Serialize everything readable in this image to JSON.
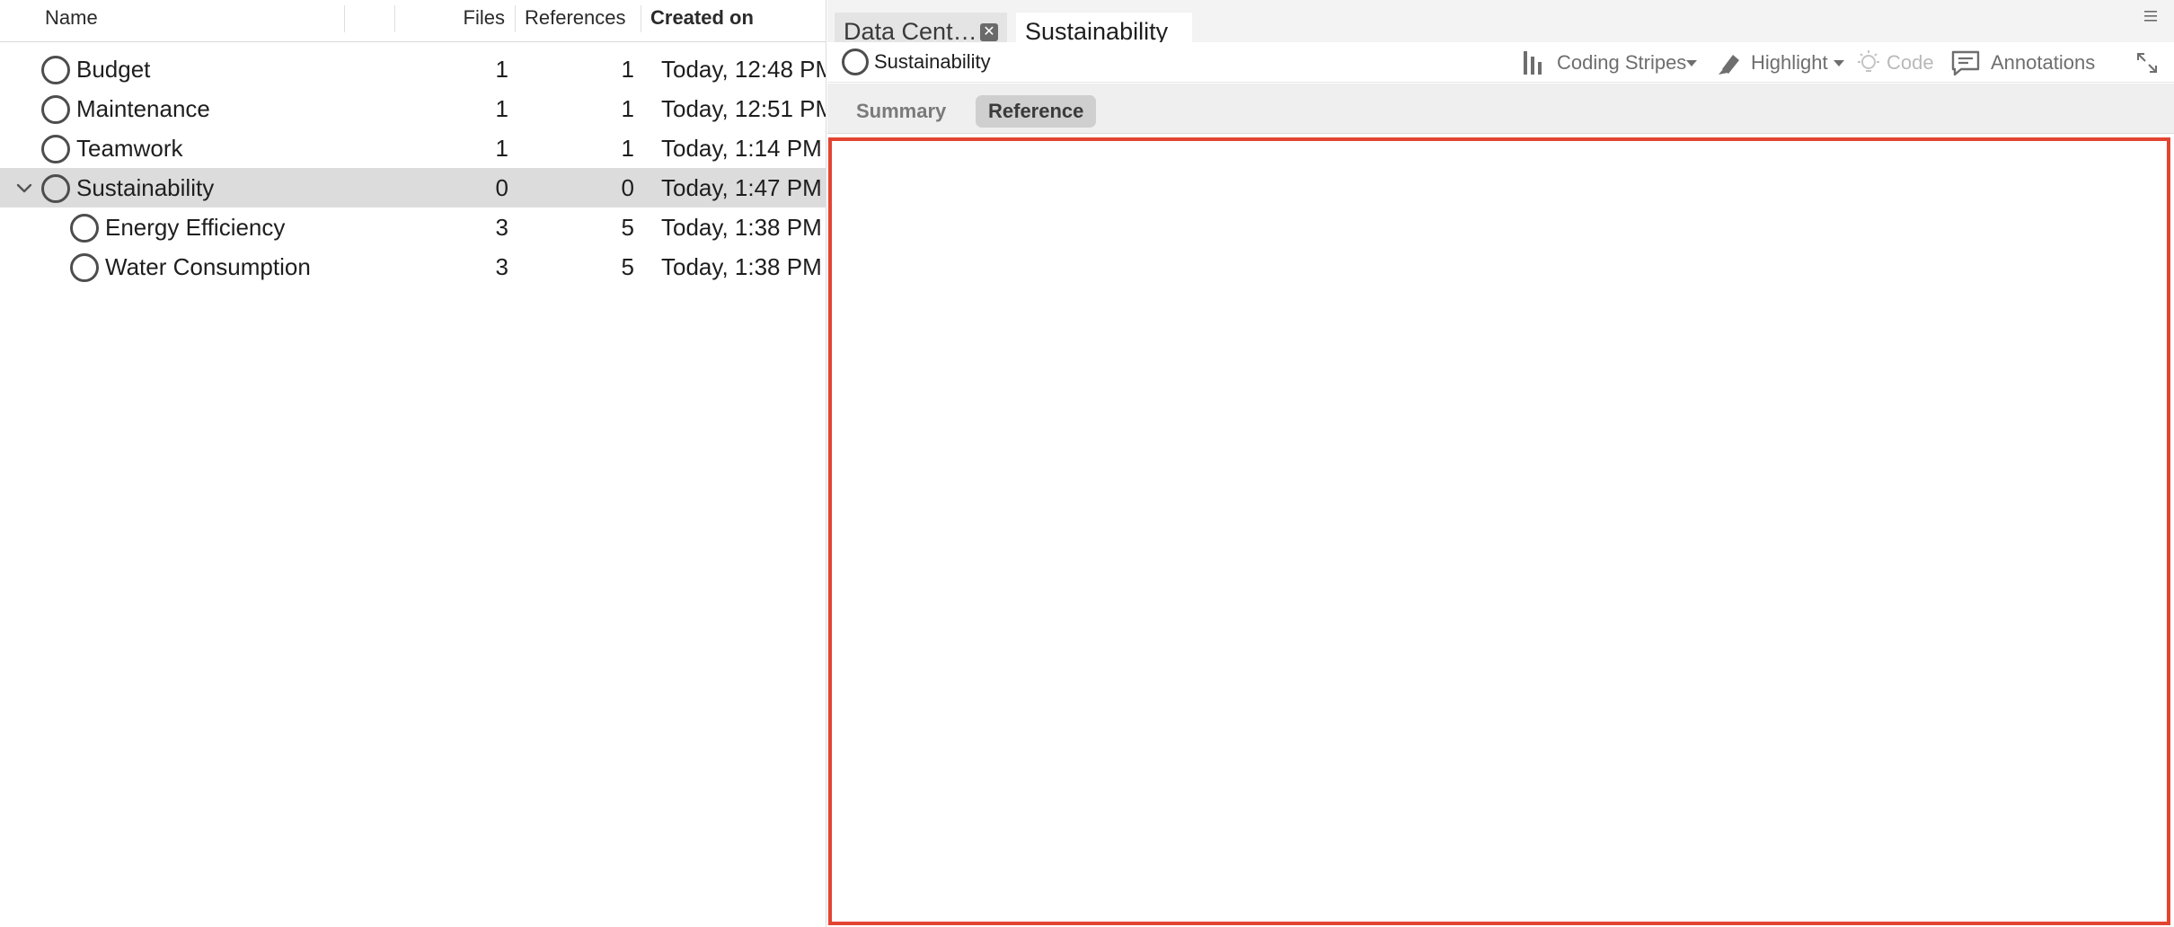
{
  "columns": {
    "name": "Name",
    "files": "Files",
    "references": "References",
    "created_on": "Created on"
  },
  "rows": [
    {
      "name": "Budget",
      "files": "1",
      "references": "1",
      "created": "Today, 12:48 PM",
      "level": 0,
      "expanded": false,
      "selected": false
    },
    {
      "name": "Maintenance",
      "files": "1",
      "references": "1",
      "created": "Today, 12:51 PM",
      "level": 0,
      "expanded": false,
      "selected": false
    },
    {
      "name": "Teamwork",
      "files": "1",
      "references": "1",
      "created": "Today, 1:14 PM",
      "level": 0,
      "expanded": false,
      "selected": false
    },
    {
      "name": "Sustainability",
      "files": "0",
      "references": "0",
      "created": "Today, 1:47 PM",
      "level": 0,
      "expanded": true,
      "selected": true
    },
    {
      "name": "Energy Efficiency",
      "files": "3",
      "references": "5",
      "created": "Today, 1:38 PM",
      "level": 1,
      "expanded": false,
      "selected": false
    },
    {
      "name": "Water Consumption",
      "files": "3",
      "references": "5",
      "created": "Today, 1:38 PM",
      "level": 1,
      "expanded": false,
      "selected": false
    }
  ],
  "tabs": [
    {
      "label": "Data Cent…",
      "closable": true,
      "active": false
    },
    {
      "label": "Sustainability",
      "closable": false,
      "active": true
    }
  ],
  "toolbar": {
    "title": "Sustainability",
    "coding_stripes": "Coding Stripes",
    "highlight": "Highlight",
    "code": "Code",
    "annotations": "Annotations"
  },
  "subtabs": {
    "summary": "Summary",
    "reference": "Reference"
  },
  "colors": {
    "selection": "#dcdcdc",
    "focus_border": "#e34432",
    "subtab_active": "#cfcfcf"
  },
  "icons": {
    "node": "circle-node-icon",
    "expand_chevron": "chevron-down-icon",
    "tab_close": "close-icon",
    "panel_menu": "hamburger-menu-icon",
    "coding_stripes": "coding-stripes-icon",
    "highlight": "highlighter-icon",
    "code": "lightbulb-icon",
    "annotations": "annotation-icon",
    "expand": "expand-icon"
  }
}
